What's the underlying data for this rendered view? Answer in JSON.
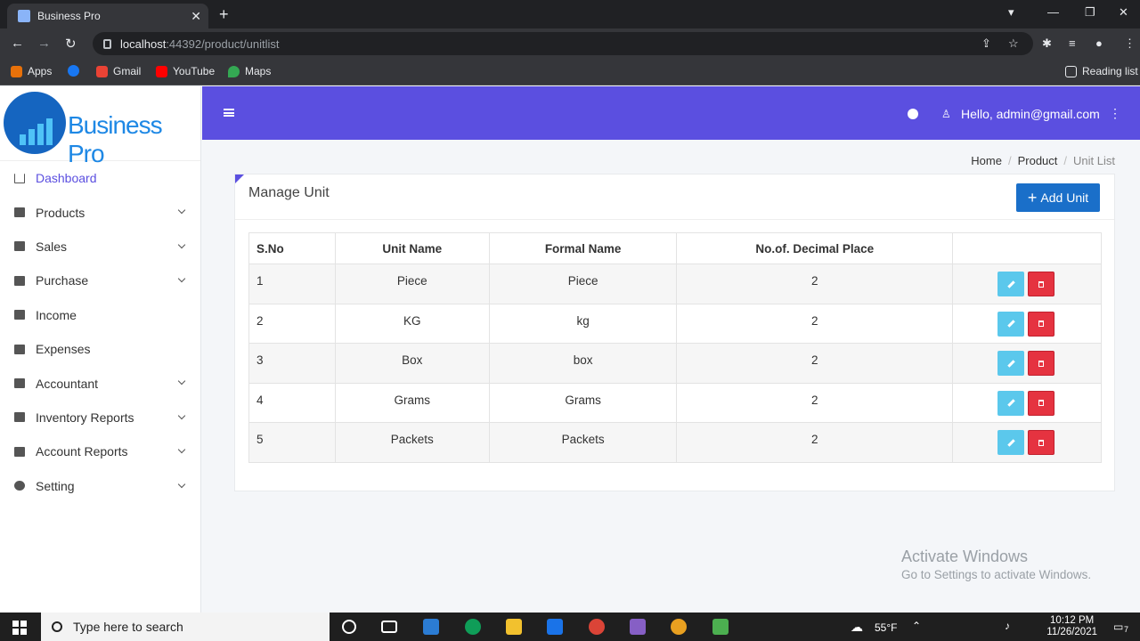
{
  "browser": {
    "tab_title": "Business Pro",
    "url_host": "localhost",
    "url_path": ":44392/product/unitlist",
    "bookmarks": [
      "Apps",
      "Gmail",
      "YouTube",
      "Maps"
    ],
    "reading_list": "Reading list"
  },
  "app": {
    "logo_text": "Business Pro",
    "greeting": "Hello, admin@gmail.com"
  },
  "sidebar": {
    "items": [
      {
        "label": "Dashboard",
        "active": true
      },
      {
        "label": "Products"
      },
      {
        "label": "Sales"
      },
      {
        "label": "Purchase"
      },
      {
        "label": "Income"
      },
      {
        "label": "Expenses"
      },
      {
        "label": "Accountant"
      },
      {
        "label": "Inventory Reports"
      },
      {
        "label": "Account Reports"
      },
      {
        "label": "Setting"
      }
    ]
  },
  "breadcrumb": {
    "home": "Home",
    "section": "Product",
    "current": "Unit List",
    "separator": "/"
  },
  "card": {
    "title": "Manage Unit",
    "add_button": "Add Unit",
    "add_icon": "+"
  },
  "table": {
    "headers": [
      "S.No",
      "Unit Name",
      "Formal Name",
      "No.of. Decimal Place"
    ],
    "rows": [
      [
        "1",
        "Piece",
        "Piece",
        "2"
      ],
      [
        "2",
        "KG",
        "kg",
        "2"
      ],
      [
        "3",
        "Box",
        "box",
        "2"
      ],
      [
        "4",
        "Grams",
        "Grams",
        "2"
      ],
      [
        "5",
        "Packets",
        "Packets",
        "2"
      ]
    ]
  },
  "watermark": {
    "title": "Activate Windows",
    "subtitle": "Go to Settings to activate Windows."
  },
  "taskbar": {
    "search_placeholder": "Type here to search",
    "weather": "55°F",
    "time": "10:12 PM",
    "date": "11/26/2021",
    "notification_count": "7"
  },
  "colors": {
    "accent": "#5b4fe0",
    "primary_button": "#1a6fc9",
    "edit_button": "#5bc8ec",
    "delete_button": "#e53340"
  }
}
